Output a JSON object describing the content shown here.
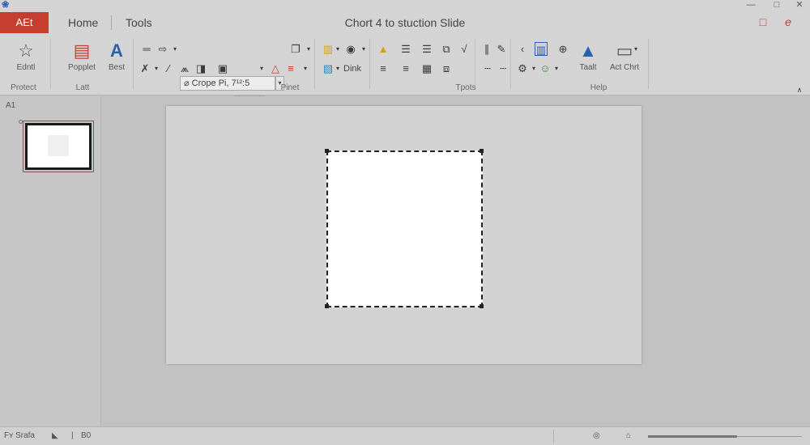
{
  "titlebar": {
    "file_tab": "AEt",
    "tabs": [
      "Home",
      "Tools"
    ],
    "document_title": "Chort 4 to stuction Slide",
    "window_controls": [
      "minimize-icon",
      "maximize-icon",
      "close-icon"
    ],
    "right_icons": [
      "square-icon",
      "share-icon"
    ]
  },
  "ribbon": {
    "font_name": "⌀ Crope Pi, 7¹²:5",
    "groups": [
      "Protect",
      "Latt",
      "Pinet",
      "Tpots",
      "Help"
    ],
    "buttons": {
      "edit": "Edntl",
      "poppler": "Popplet",
      "best": "Best",
      "dink": "Dink",
      "table": "Taalt",
      "act_chart": "Act Chrt"
    }
  },
  "thumbnails": {
    "label": "A1",
    "count": 1
  },
  "statusbar": {
    "left_text": "Fʏ Srafa",
    "page_number": "B0"
  },
  "colors": {
    "accent": "#c63e2f",
    "ribbon_bg": "#d4d4d4",
    "workspace_bg": "#c2c2c2",
    "slide_bg": "#d3d3d3"
  }
}
